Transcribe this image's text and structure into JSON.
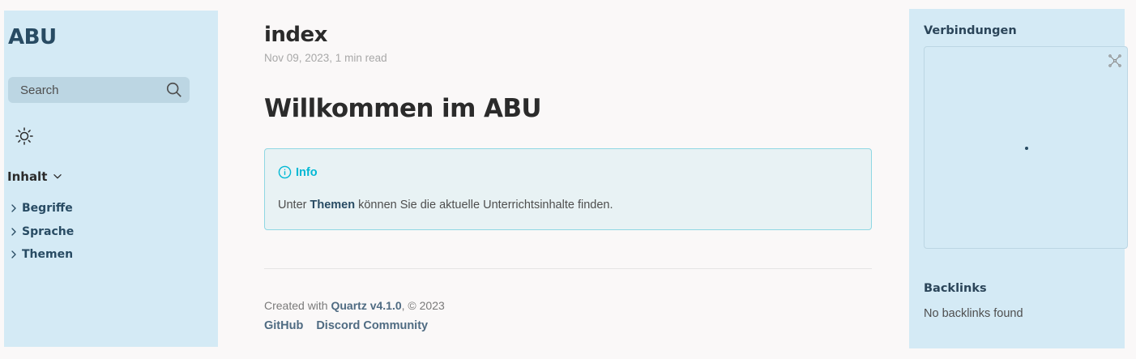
{
  "left_sidebar": {
    "site_title": "ABU",
    "search": {
      "placeholder": "Search"
    },
    "theme_toggle_icon": "sun-icon",
    "explorer": {
      "title": "Inhalt",
      "items": [
        {
          "label": "Begriffe"
        },
        {
          "label": "Sprache"
        },
        {
          "label": "Themen"
        }
      ]
    }
  },
  "main": {
    "page_title": "index",
    "meta": "Nov 09, 2023, 1 min read",
    "heading": "Willkommen im ABU",
    "callout": {
      "title": "Info",
      "body_before": "Unter ",
      "body_link": "Themen",
      "body_after": " können Sie die aktuelle Unterrichtsinhalte finden."
    },
    "footer": {
      "created_prefix": "Created with ",
      "quartz": "Quartz v4.1.0",
      "copyright": ", © 2023",
      "links": [
        {
          "label": "GitHub"
        },
        {
          "label": "Discord Community"
        }
      ]
    }
  },
  "right_sidebar": {
    "graph_title": "Verbindungen",
    "backlinks_title": "Backlinks",
    "backlinks_empty": "No backlinks found"
  },
  "colors": {
    "sidebar_bg": "#d4eaf5",
    "page_bg": "#faf8f8",
    "accent": "#284b63",
    "callout_accent": "#00b8d4"
  }
}
